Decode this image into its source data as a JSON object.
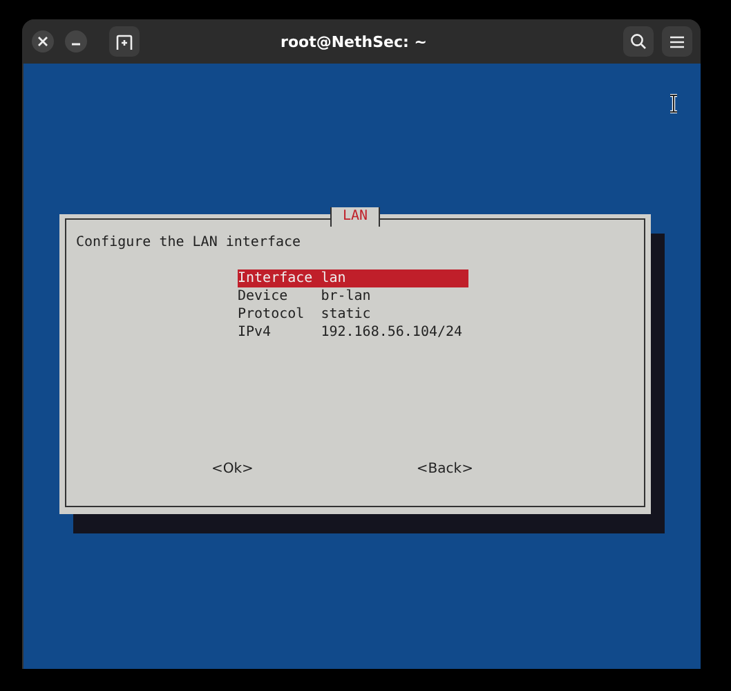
{
  "window": {
    "title": "root@NethSec: ~"
  },
  "dialog": {
    "title": "LAN",
    "prompt": "Configure the LAN interface",
    "items": [
      {
        "label": "Interface",
        "value": "lan",
        "selected": true
      },
      {
        "label": "Device",
        "value": "br-lan",
        "selected": false
      },
      {
        "label": "Protocol",
        "value": "static",
        "selected": false
      },
      {
        "label": "IPv4",
        "value": "192.168.56.104/24",
        "selected": false
      }
    ],
    "buttons": [
      "<Ok>",
      "<Back>"
    ]
  }
}
